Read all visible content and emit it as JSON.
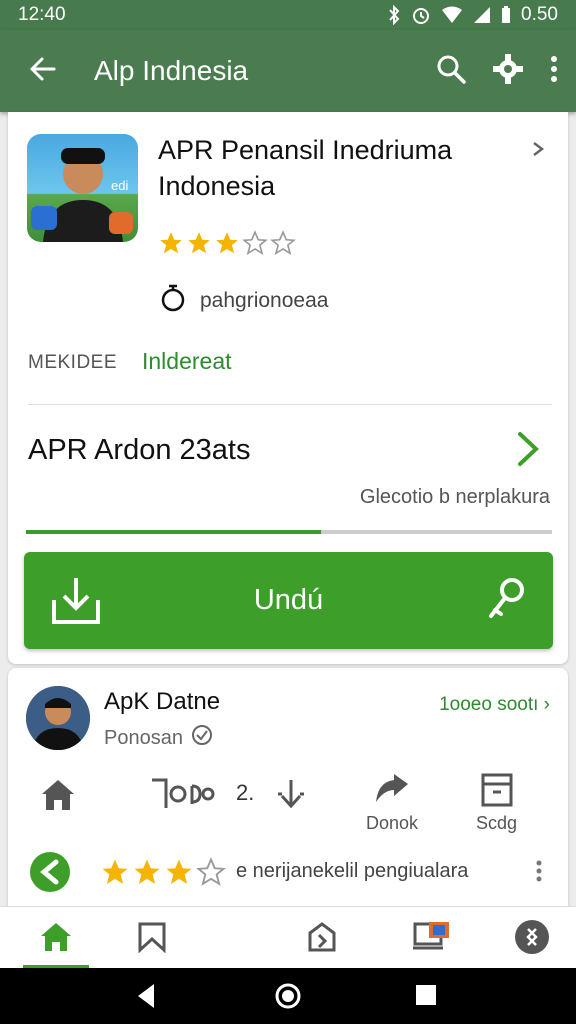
{
  "status_bar": {
    "time": "12:40",
    "battery_text": "0.50"
  },
  "app_bar": {
    "title": "Alp Indnesia",
    "icons": [
      "back-arrow-icon",
      "search-icon",
      "settings-icon",
      "more-vert-icon"
    ]
  },
  "app_info": {
    "name": "APR Penansil Inedriuma Indonesia",
    "rating": 3,
    "max_rating": 5,
    "developer": "pahgrionoeaa",
    "meta_label": "MEKIDEE",
    "meta_value": "Inldereat"
  },
  "section": {
    "title": "APR Ardon 23ats",
    "subtitle": "Glecotio b nerplakura",
    "progress": 0.56
  },
  "download": {
    "label": "Undú"
  },
  "developer_card": {
    "name": "ApK Datne",
    "subtitle": "Ponosan",
    "link": "1ooeo sootı ›",
    "actions": [
      {
        "icon": "home-icon",
        "label": ""
      },
      {
        "icon": "share-icon",
        "label": "Donok"
      },
      {
        "icon": "storage-icon",
        "label": "Scdg"
      }
    ],
    "counter_text": "2.",
    "review_rating": 3,
    "review_text": "e nerijanekelil  pengiualara"
  },
  "bottom_nav": {
    "items": [
      "home-icon",
      "bookmark-icon",
      "apps-icon",
      "media-icon",
      "settings-icon"
    ]
  },
  "colors": {
    "accent": "#3d9e2a",
    "app_bar": "#4a7c4f",
    "text_green": "#2e8b2e",
    "star": "#f5b400"
  }
}
